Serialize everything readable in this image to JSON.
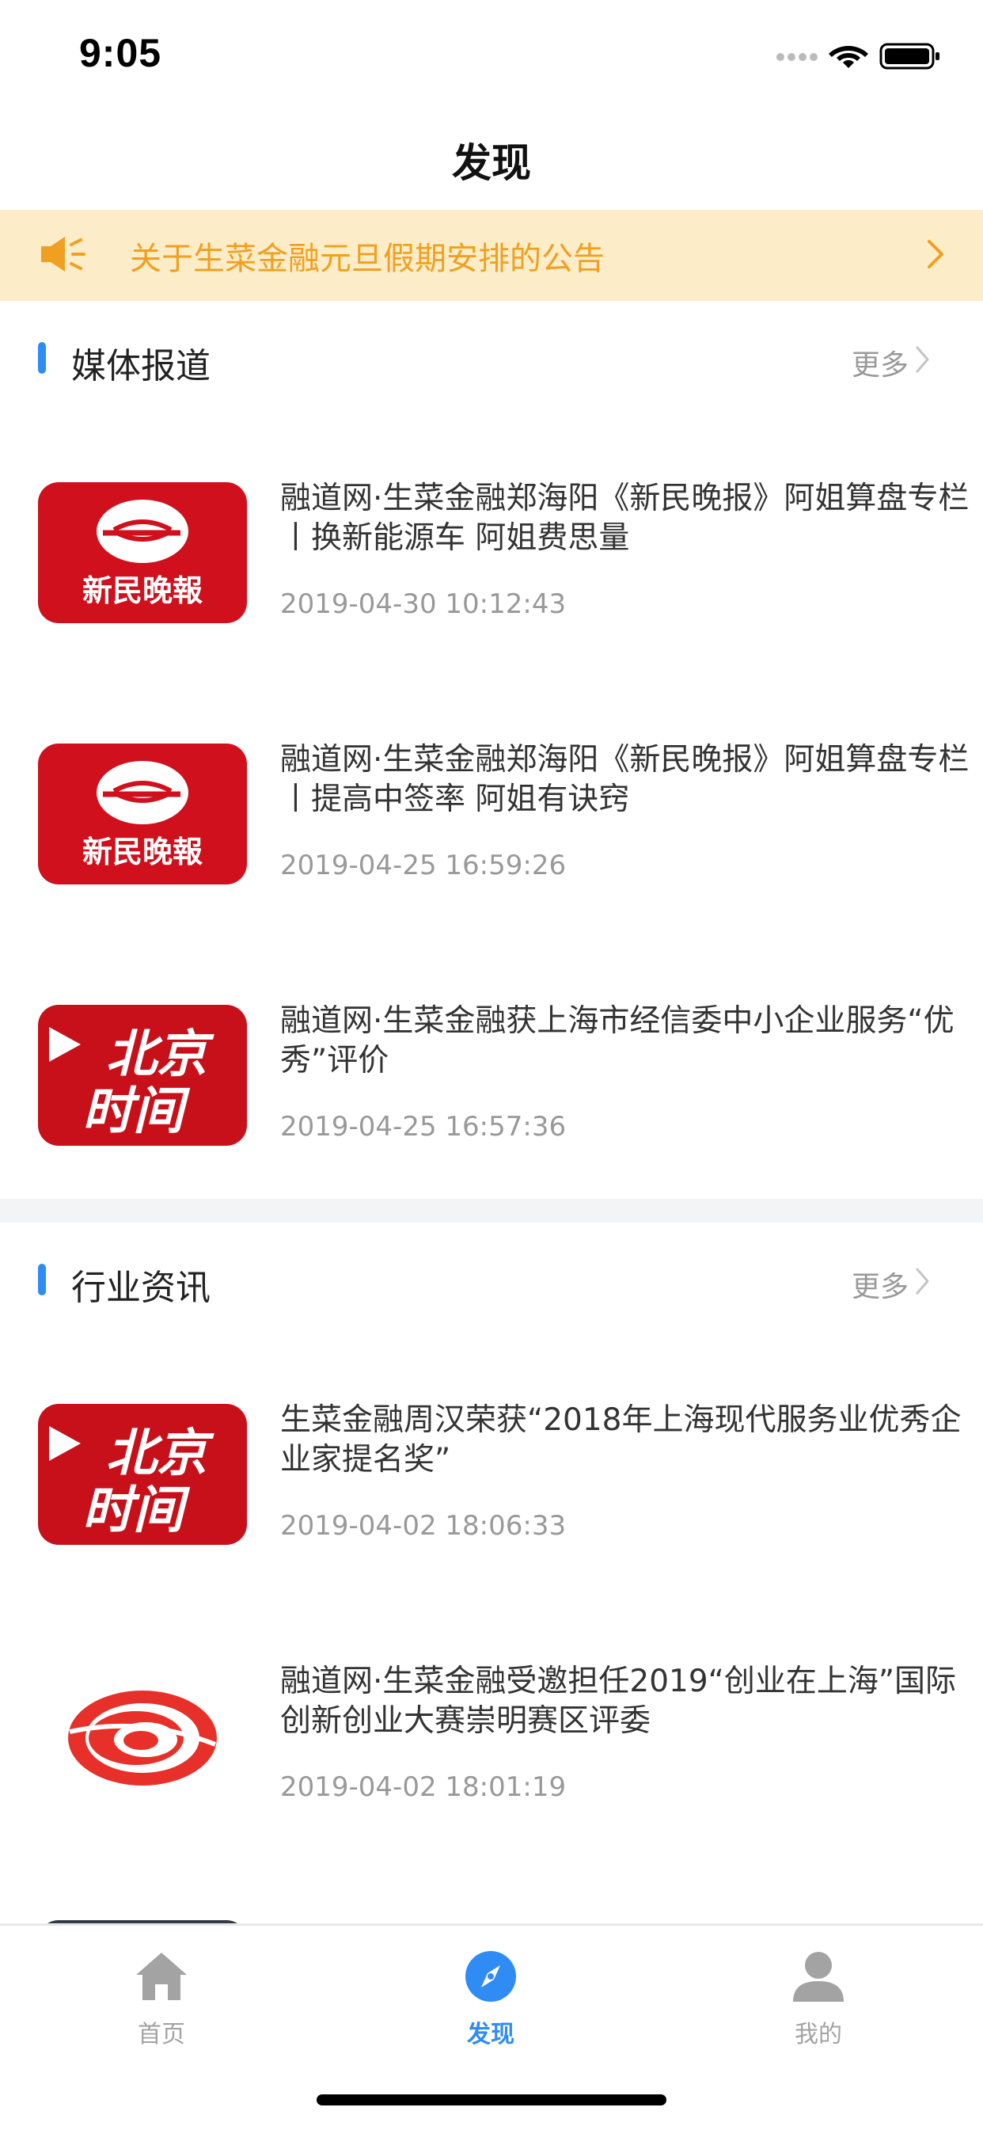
{
  "status": {
    "time": "9:05"
  },
  "nav": {
    "title": "发现"
  },
  "notice": {
    "text": "关于生菜金融元旦假期安排的公告"
  },
  "media_section": {
    "title": "媒体报道",
    "more": "更多",
    "articles": [
      {
        "title": "融道网·生菜金融郑海阳《新民晚报》阿姐算盘专栏丨换新能源车 阿姐费思量",
        "date": "2019-04-30 10:12:43",
        "logo": "xinmin-logo"
      },
      {
        "title": "融道网·生菜金融郑海阳《新民晚报》阿姐算盘专栏丨提高中签率 阿姐有诀窍",
        "date": "2019-04-25 16:59:26",
        "logo": "xinmin-logo"
      },
      {
        "title": "融道网·生菜金融获上海市经信委中小企业服务“优秀”评价",
        "date": "2019-04-25 16:57:36",
        "logo": "beijing-time-logo"
      }
    ]
  },
  "industry_section": {
    "title": "行业资讯",
    "more": "更多",
    "articles": [
      {
        "title": "生菜金融周汉荣获“2018年上海现代服务业优秀企业家提名奖”",
        "date": "2019-04-02 18:06:33",
        "logo": "beijing-time-logo"
      },
      {
        "title": "融道网·生菜金融受邀担任2019“创业在上海”国际创新创业大赛崇明赛区评委",
        "date": "2019-04-02 18:01:19",
        "logo": "phoenix-logo"
      }
    ]
  },
  "logos": {
    "xinmin": "新民晚報",
    "beijing_top": "北京",
    "beijing_bottom": "时间"
  },
  "tabs": [
    {
      "label": "首页",
      "icon": "home-icon",
      "active": false
    },
    {
      "label": "发现",
      "icon": "compass-icon",
      "active": true
    },
    {
      "label": "我的",
      "icon": "user-icon",
      "active": false
    }
  ],
  "colors": {
    "accent": "#2f8cf5",
    "notice_bg": "#fdecc8",
    "notice_text": "#f0a020",
    "logo_red": "#d0101c",
    "inactive_tab": "#a3a3a3"
  }
}
